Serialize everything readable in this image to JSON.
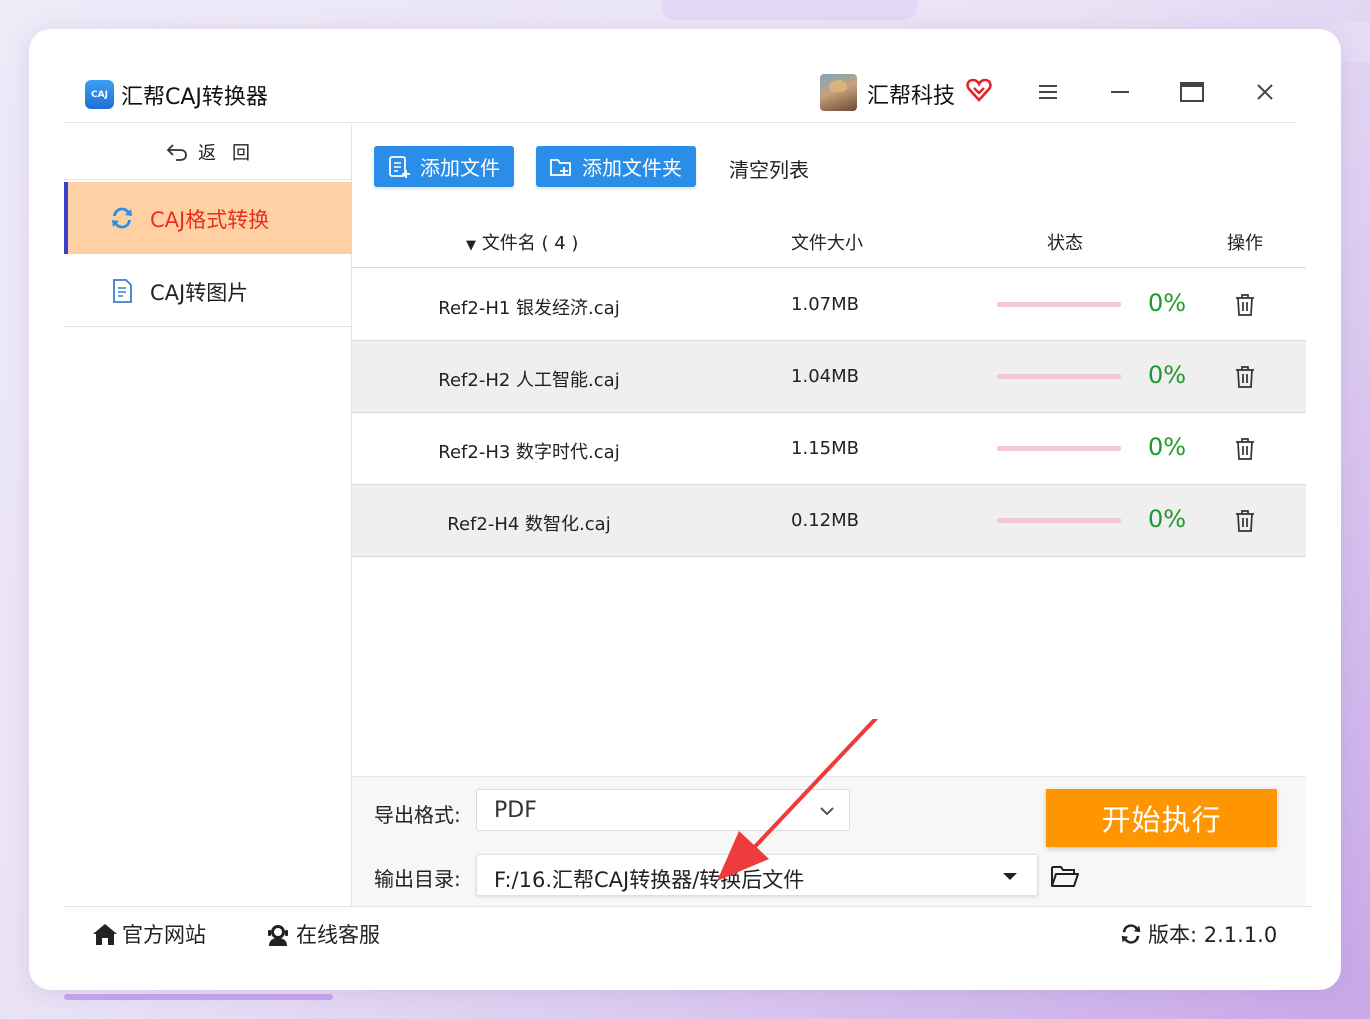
{
  "window": {
    "app_title": "汇帮CAJ转换器",
    "logo_text": "CAJ",
    "user_name": "汇帮科技"
  },
  "sidebar": {
    "back_label": "返回",
    "items": [
      {
        "label": "CAJ格式转换",
        "icon": "refresh-icon",
        "active": true
      },
      {
        "label": "CAJ转图片",
        "icon": "document-icon",
        "active": false
      }
    ]
  },
  "toolbar": {
    "add_file": "添加文件",
    "add_folder": "添加文件夹",
    "clear_list": "清空列表"
  },
  "table": {
    "headers": {
      "name": "文件名 ( 4 )",
      "size": "文件大小",
      "status": "状态",
      "op": "操作"
    },
    "rows": [
      {
        "name": "Ref2-H1 银发经济.caj",
        "size": "1.07MB",
        "progress": "0%"
      },
      {
        "name": "Ref2-H2 人工智能.caj",
        "size": "1.04MB",
        "progress": "0%"
      },
      {
        "name": "Ref2-H3 数字时代.caj",
        "size": "1.15MB",
        "progress": "0%"
      },
      {
        "name": "Ref2-H4 数智化.caj",
        "size": "0.12MB",
        "progress": "0%"
      }
    ]
  },
  "bottom": {
    "format_label": "导出格式:",
    "format_value": "PDF",
    "dir_label": "输出目录:",
    "dir_value": "F:/16.汇帮CAJ转换器/转换后文件",
    "start_label": "开始执行"
  },
  "footer": {
    "site": "官方网站",
    "service": "在线客服",
    "version": "版本: 2.1.1.0"
  },
  "colors": {
    "primary_blue": "#2a8ee9",
    "active_nav_bg": "#ffd0a4",
    "active_nav_text": "#ea2f1c",
    "progress_green": "#1f9b2c",
    "start_orange": "#ff9500",
    "arrow_red": "#ee3b3b"
  }
}
